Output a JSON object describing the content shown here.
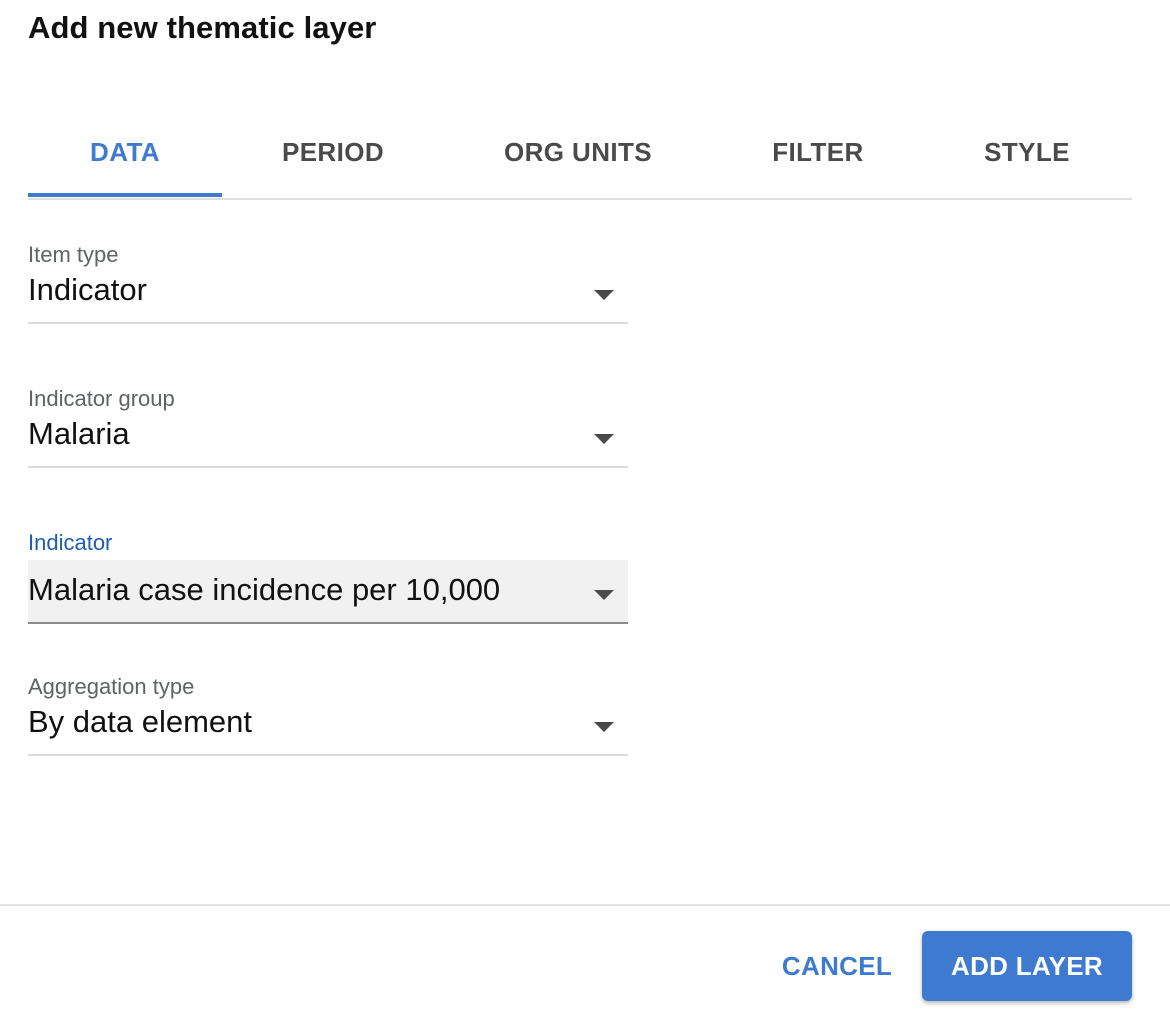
{
  "dialog": {
    "title": "Add new thematic layer"
  },
  "tabs": [
    {
      "label": "DATA",
      "active": true
    },
    {
      "label": "PERIOD",
      "active": false
    },
    {
      "label": "ORG UNITS",
      "active": false
    },
    {
      "label": "FILTER",
      "active": false
    },
    {
      "label": "STYLE",
      "active": false
    }
  ],
  "form": {
    "item_type": {
      "label": "Item type",
      "value": "Indicator"
    },
    "indicator_group": {
      "label": "Indicator group",
      "value": "Malaria"
    },
    "indicator": {
      "label": "Indicator",
      "value": "Malaria case incidence per 10,000",
      "focused": true
    },
    "aggregation_type": {
      "label": "Aggregation type",
      "value": "By data element"
    }
  },
  "actions": {
    "cancel_label": "CANCEL",
    "add_label": "ADD LAYER"
  },
  "colors": {
    "accent": "#3e7bd0",
    "focused_label": "#1f5cb5"
  }
}
